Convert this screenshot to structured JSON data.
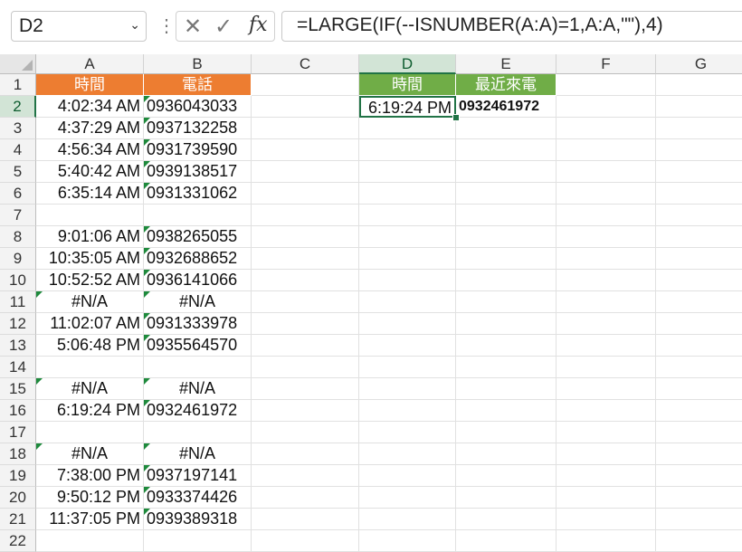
{
  "name_box": {
    "value": "D2"
  },
  "formula_bar": {
    "cancel_glyph": "✕",
    "enter_glyph": "✓",
    "fx_label": "fx",
    "formula": "=LARGE(IF(--ISNUMBER(A:A)=1,A:A,\"\"),4)"
  },
  "columns": [
    "A",
    "B",
    "C",
    "D",
    "E",
    "F",
    "G"
  ],
  "selected_column": "D",
  "selected_row": 2,
  "rows": [
    "1",
    "2",
    "3",
    "4",
    "5",
    "6",
    "7",
    "8",
    "9",
    "10",
    "11",
    "12",
    "13",
    "14",
    "15",
    "16",
    "17",
    "18",
    "19",
    "20",
    "21",
    "22"
  ],
  "headers": {
    "A1": "時間",
    "B1": "電話",
    "D1": "時間",
    "E1": "最近來電"
  },
  "data_rows": [
    {
      "time": "4:02:34 AM",
      "phone": "0936043033"
    },
    {
      "time": "4:37:29 AM",
      "phone": "0937132258"
    },
    {
      "time": "4:56:34 AM",
      "phone": "0931739590"
    },
    {
      "time": "5:40:42 AM",
      "phone": "0939138517"
    },
    {
      "time": "6:35:14 AM",
      "phone": "0931331062"
    },
    {
      "time": "",
      "phone": ""
    },
    {
      "time": "9:01:06 AM",
      "phone": "0938265055"
    },
    {
      "time": "10:35:05 AM",
      "phone": "0932688652"
    },
    {
      "time": "10:52:52 AM",
      "phone": "0936141066"
    },
    {
      "time": "#N/A",
      "phone": "#N/A"
    },
    {
      "time": "11:02:07 AM",
      "phone": "0931333978"
    },
    {
      "time": "5:06:48 PM",
      "phone": "0935564570"
    },
    {
      "time": "",
      "phone": ""
    },
    {
      "time": "#N/A",
      "phone": "#N/A"
    },
    {
      "time": "6:19:24 PM",
      "phone": "0932461972"
    },
    {
      "time": "",
      "phone": ""
    },
    {
      "time": "#N/A",
      "phone": "#N/A"
    },
    {
      "time": "7:38:00 PM",
      "phone": "0937197141"
    },
    {
      "time": "9:50:12 PM",
      "phone": "0933374426"
    },
    {
      "time": "11:37:05 PM",
      "phone": "0939389318"
    },
    {
      "time": "",
      "phone": ""
    }
  ],
  "result": {
    "D2": "6:19:24 PM",
    "E2": "0932461972"
  },
  "colors": {
    "orange_header": "#ed7d31",
    "green_header": "#70ad47",
    "selection": "#217346",
    "error_indicator": "#1e8a3c"
  }
}
